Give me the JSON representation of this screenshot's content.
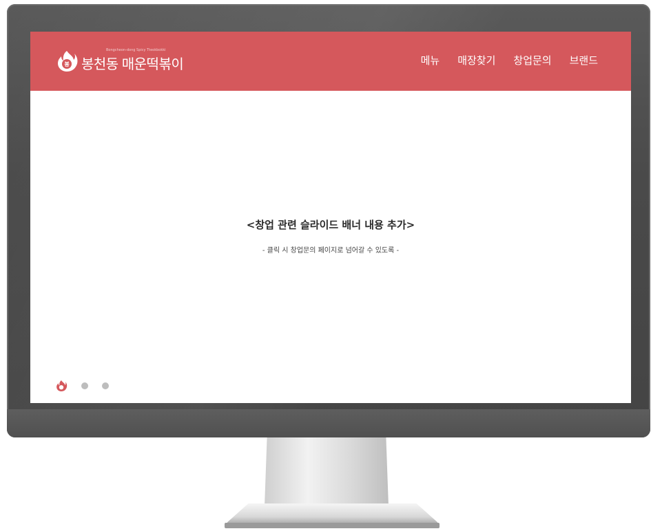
{
  "brand": {
    "name": "봉천동 매운떡볶이",
    "tagline": "Bongcheon-dong Spicy Tteokbokki",
    "accent_color": "#d5585c"
  },
  "nav": {
    "items": [
      {
        "label": "메뉴"
      },
      {
        "label": "매장찾기"
      },
      {
        "label": "창업문의"
      },
      {
        "label": "브랜드"
      }
    ]
  },
  "banner": {
    "title": "<창업 관련 슬라이드 배너 내용 추가>",
    "subtitle": "- 클릭 시 창업문의 페이지로 넘어갈 수 있도록 -"
  },
  "pager": {
    "active_icon": "flame-logo-icon",
    "total_slides": 3,
    "active_index": 0
  }
}
